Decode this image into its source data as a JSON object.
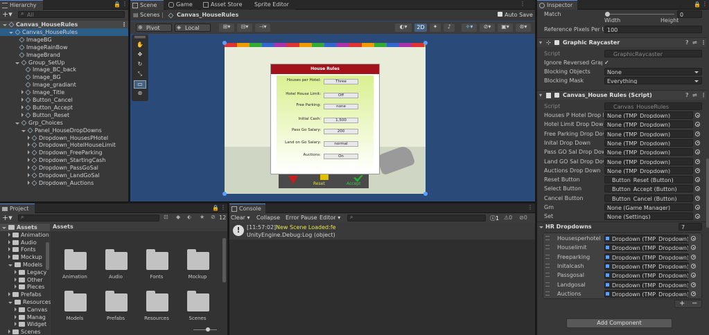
{
  "hierarchy": {
    "tab": "Hierarchy",
    "search_placeholder": "All",
    "items": [
      {
        "label": "Canvas_HouseRules",
        "indent": 0,
        "type": "scene"
      },
      {
        "label": "Canvas_HouseRules",
        "indent": 1,
        "type": "open"
      },
      {
        "label": "ImageBG",
        "indent": 2,
        "type": "leaf"
      },
      {
        "label": "ImageRainBow",
        "indent": 2,
        "type": "leaf"
      },
      {
        "label": "ImageBrand",
        "indent": 2,
        "type": "leaf"
      },
      {
        "label": "Group_SetUp",
        "indent": 2,
        "type": "open"
      },
      {
        "label": "Image_BC_back",
        "indent": 3,
        "type": "leaf"
      },
      {
        "label": "Image_BG",
        "indent": 3,
        "type": "leaf"
      },
      {
        "label": "Image_gradiant",
        "indent": 3,
        "type": "leaf"
      },
      {
        "label": "Image_Title",
        "indent": 3,
        "type": "closed"
      },
      {
        "label": "Button_Cancel",
        "indent": 3,
        "type": "closed"
      },
      {
        "label": "Button_Accept",
        "indent": 3,
        "type": "closed"
      },
      {
        "label": "Button_Reset",
        "indent": 3,
        "type": "closed"
      },
      {
        "label": "Grp_Choices",
        "indent": 2,
        "type": "open"
      },
      {
        "label": "Panel_HouseDropDowns",
        "indent": 3,
        "type": "open"
      },
      {
        "label": "Dropdown_HousesPHotel",
        "indent": 4,
        "type": "closed"
      },
      {
        "label": "Dropdown_HotelHouseLimit",
        "indent": 4,
        "type": "closed"
      },
      {
        "label": "Dropdown_FreeParking",
        "indent": 4,
        "type": "closed"
      },
      {
        "label": "Dropdown_StartingCash",
        "indent": 4,
        "type": "closed"
      },
      {
        "label": "Dropdown_PassGoSal",
        "indent": 4,
        "type": "closed"
      },
      {
        "label": "Dropdown_LandGoSal",
        "indent": 4,
        "type": "closed"
      },
      {
        "label": "Dropdown_Auctions",
        "indent": 4,
        "type": "closed"
      }
    ]
  },
  "scene": {
    "tabs": [
      "Scene",
      "Game",
      "Asset Store",
      "Sprite Editor"
    ],
    "breadcrumb": [
      "Scenes",
      "Canvas_HouseRules"
    ],
    "autosave": "Auto Save",
    "pivot": "Pivot",
    "local": "Local",
    "mode2d": "2D"
  },
  "game_panel": {
    "title": "House Rules",
    "rows": [
      {
        "label": "Houses per Hotel:",
        "value": "Three"
      },
      {
        "label": "Hotel House Limit:",
        "value": "Off"
      },
      {
        "label": "Free Parking:",
        "value": "none"
      },
      {
        "label": "Initial Cash:",
        "value": "1,500"
      },
      {
        "label": "Pass Go Salary:",
        "value": "200"
      },
      {
        "label": "Land on Go Salary:",
        "value": "normal"
      },
      {
        "label": "Auctions:",
        "value": "On"
      }
    ],
    "reset": "Reset",
    "accept": "Accept"
  },
  "project": {
    "tab": "Project",
    "count": "12",
    "tree": [
      {
        "label": "Assets",
        "indent": 0,
        "open": true
      },
      {
        "label": "Animation",
        "indent": 1,
        "open": false
      },
      {
        "label": "Audio",
        "indent": 1,
        "open": false
      },
      {
        "label": "Fonts",
        "indent": 1,
        "open": false
      },
      {
        "label": "Mockup",
        "indent": 1,
        "open": false
      },
      {
        "label": "Models",
        "indent": 1,
        "open": true
      },
      {
        "label": "Legacy",
        "indent": 2,
        "open": false
      },
      {
        "label": "Other",
        "indent": 2,
        "open": false
      },
      {
        "label": "Pieces",
        "indent": 2,
        "open": false
      },
      {
        "label": "Prefabs",
        "indent": 1,
        "open": false
      },
      {
        "label": "Resources",
        "indent": 1,
        "open": true
      },
      {
        "label": "Canvas",
        "indent": 2,
        "open": false
      },
      {
        "label": "Manag",
        "indent": 2,
        "open": false
      },
      {
        "label": "Widget",
        "indent": 2,
        "open": false
      },
      {
        "label": "Scenes",
        "indent": 1,
        "open": false
      }
    ],
    "header": "Assets",
    "grid": [
      "Animation",
      "Audio",
      "Fonts",
      "Mockup",
      "Models",
      "Prefabs",
      "Resources",
      "Scenes"
    ]
  },
  "console": {
    "tab": "Console",
    "clear": "Clear",
    "collapse": "Collapse",
    "error_pause": "Error Pause",
    "editor": "Editor",
    "counts": [
      "1",
      "0",
      "0"
    ],
    "log_time": "[11:57:02]",
    "log_msg": "New Scene Loaded:fe",
    "log_sub": "UnityEngine.Debug:Log (object)"
  },
  "inspector": {
    "tab": "Inspector",
    "match_label": "Match",
    "match_value": "0",
    "width": "Width",
    "height": "Height",
    "ref_label": "Reference Pixels Per U",
    "ref_value": "100",
    "raycaster": {
      "title": "Graphic Raycaster",
      "script_label": "Script",
      "script": "GraphicRaycaster",
      "ignore": "Ignore Reversed Graph",
      "blocking_objects": "Blocking Objects",
      "blocking_objects_val": "None",
      "blocking_mask": "Blocking Mask",
      "blocking_mask_val": "Everything"
    },
    "script_comp": {
      "title": "Canvas_House Rules (Script)",
      "script_label": "Script",
      "script": "Canvas_HouseRules",
      "fields": [
        {
          "label": "Houses P Hotel Drop D",
          "value": "None (TMP_Dropdown)"
        },
        {
          "label": "Hotel Limit Drop Down",
          "value": "None (TMP_Dropdown)"
        },
        {
          "label": "Free Parking Drop Dow",
          "value": "None (TMP_Dropdown)"
        },
        {
          "label": "Inital Drop Down",
          "value": "None (TMP_Dropdown)"
        },
        {
          "label": "Pass GO Sal Drop Dow",
          "value": "None (TMP_Dropdown)"
        },
        {
          "label": "Land GO Sal Drop Dow",
          "value": "None (TMP_Dropdown)"
        },
        {
          "label": "Auctions Drop Down",
          "value": "None (TMP_Dropdown)"
        },
        {
          "label": "Reset Button",
          "value": "Button_Reset (Button)"
        },
        {
          "label": "Select Button",
          "value": "Button_Accept (Button)"
        },
        {
          "label": "Cancel Button",
          "value": "Button_Cancel (Button)"
        },
        {
          "label": "Gm",
          "value": "None (Game Manager)"
        },
        {
          "label": "Set",
          "value": "None (Settings)"
        }
      ]
    },
    "hr": {
      "label": "HR Dropdowns",
      "count": "7",
      "items": [
        {
          "label": "Housesperhotel",
          "value": "Dropdown (TMP_Dropdown)"
        },
        {
          "label": "Houselimit",
          "value": "Dropdown (TMP_Dropdown)"
        },
        {
          "label": "Freeparking",
          "value": "Dropdown (TMP_Dropdown)"
        },
        {
          "label": "Initalcash",
          "value": "Dropdown (TMP_Dropdown)"
        },
        {
          "label": "Passgosal",
          "value": "Dropdown (TMP_Dropdown)"
        },
        {
          "label": "Landgosal",
          "value": "Dropdown (TMP_Dropdown)"
        },
        {
          "label": "Auctions",
          "value": "Dropdown (TMP_Dropdown)"
        }
      ]
    },
    "add_component": "Add Component"
  }
}
